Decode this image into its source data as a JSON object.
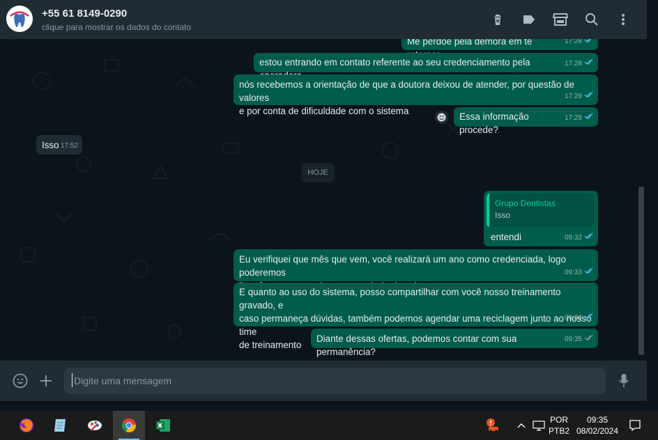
{
  "header": {
    "contact_name": "+55 61 8149-0290",
    "contact_subtitle": "clique para mostrar os dados do contato",
    "icons": [
      "trash-icon",
      "label-icon",
      "store-icon",
      "search-icon",
      "menu-icon"
    ]
  },
  "messages": [
    {
      "direction": "out",
      "text": "Me perdoe pela demora em te retornar",
      "time": "17:28"
    },
    {
      "direction": "out",
      "text": "estou entrando em contato referente ao seu credenciamento pela operadora",
      "time": "17:28"
    },
    {
      "direction": "out",
      "text": "nós recebemos a orientação de que a doutora deixou de atender, por questão de valores\ne por conta de dificuldade com o sistema",
      "time": "17:29"
    },
    {
      "direction": "out",
      "text": "Essa informação procede?",
      "time": "17:29"
    },
    {
      "direction": "in",
      "text": "Isso",
      "time": "17:52"
    },
    {
      "direction": "out",
      "text": "entendi",
      "time": "09:32",
      "quote": {
        "title": "Grupo Dentistas",
        "text": "Isso"
      }
    },
    {
      "direction": "out",
      "text": "Eu verifiquei que mês que vem, você realizará um ano como credenciada, logo poderemos\nlhe oferecer um reajuste para tabela de valores",
      "time": "09:33"
    },
    {
      "direction": "out",
      "text": "E quanto ao uso do sistema, posso compartilhar com você nosso treinamento gravado, e\ncaso permaneça dúvidas, também podemos agendar uma reciclagem junto ao nosso time\nde treinamento",
      "time": "09:34"
    },
    {
      "direction": "out",
      "text": "Diante dessas ofertas, podemos contar com sua permanência?",
      "time": "09:35"
    }
  ],
  "date_divider": "HOJE",
  "composer": {
    "placeholder": "Digite uma mensagem"
  },
  "taskbar": {
    "language_line1": "POR",
    "language_line2": "PTB2",
    "time": "09:35",
    "date": "08/02/2024",
    "apps": [
      "firefox-icon",
      "notepad-icon",
      "paint-icon",
      "chrome-icon",
      "excel-icon"
    ]
  },
  "colors": {
    "outgoing_bubble": "#005c4b",
    "incoming_bubble": "#202c33",
    "header": "#202c33",
    "chat_bg": "#0b141a",
    "tick_blue": "#53bdeb",
    "accent": "#06cf9c"
  }
}
